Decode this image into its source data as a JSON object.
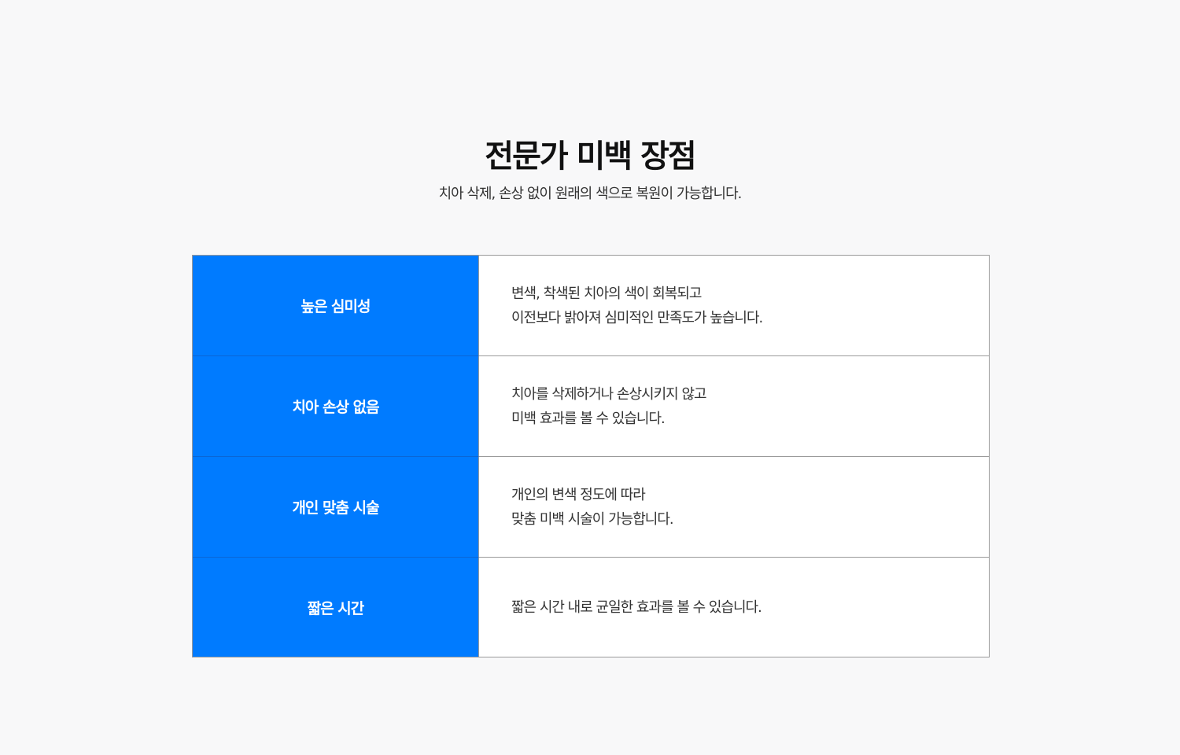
{
  "header": {
    "title": "전문가 미백 장점",
    "subtitle": "치아 삭제, 손상 없이 원래의 색으로 복원이 가능합니다."
  },
  "benefits": [
    {
      "title": "높은 심미성",
      "lines": [
        "변색, 착색된 치아의 색이 회복되고",
        "이전보다 밝아져 심미적인 만족도가 높습니다."
      ]
    },
    {
      "title": "치아 손상 없음",
      "lines": [
        "치아를 삭제하거나 손상시키지 않고",
        "미백 효과를 볼 수 있습니다."
      ]
    },
    {
      "title": "개인 맞춤 시술",
      "lines": [
        "개인의 변색 정도에 따라",
        "맞춤 미백 시술이 가능합니다."
      ]
    },
    {
      "title": "짧은 시간",
      "lines": [
        "짧은 시간 내로 균일한 효과를 볼 수 있습니다."
      ]
    }
  ],
  "colors": {
    "accent": "#007bff",
    "background": "#f8f8f9",
    "border": "#9a9a9a"
  }
}
